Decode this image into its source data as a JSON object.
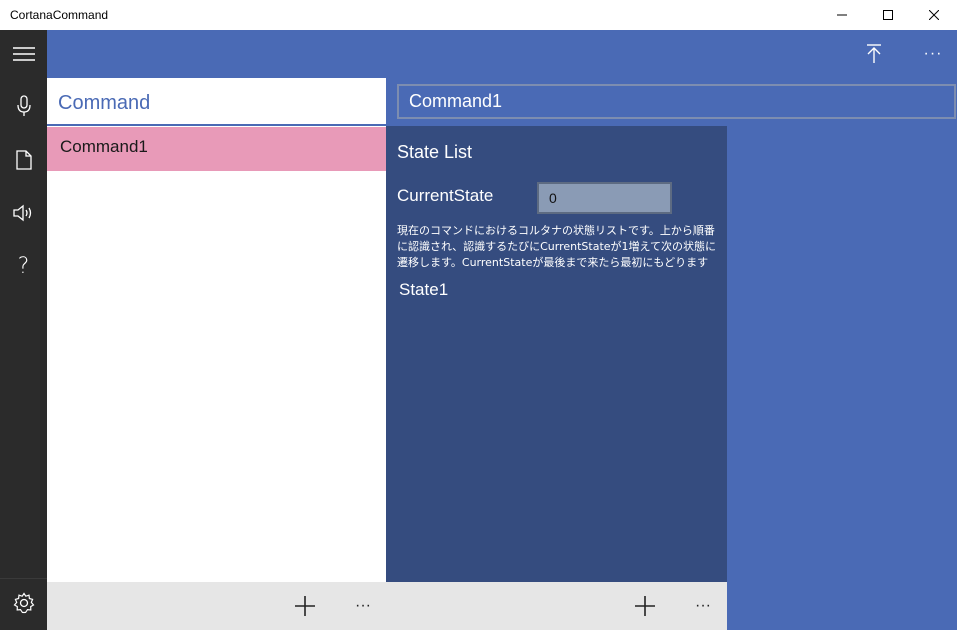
{
  "window": {
    "title": "CortanaCommand"
  },
  "rail": {
    "items": [
      {
        "icon": "hamburger-icon"
      },
      {
        "icon": "microphone-icon"
      },
      {
        "icon": "document-icon"
      },
      {
        "icon": "speaker-icon"
      },
      {
        "icon": "help-icon",
        "glyph": "?"
      }
    ],
    "settings_icon": "gear-icon"
  },
  "header": {
    "more_label": "···"
  },
  "command_list": {
    "title": "Command",
    "items": [
      {
        "label": "Command1"
      }
    ]
  },
  "command_name": {
    "value": "Command1"
  },
  "state_panel": {
    "title": "State List",
    "current_state_label": "CurrentState",
    "current_state_value": "0",
    "description": "現在のコマンドにおけるコルタナの状態リストです。上から順番に認識され、認識するたびにCurrentStateが1増えて次の状態に遷移します。CurrentStateが最後まで来たら最初にもどります",
    "states": [
      {
        "label": "State1"
      }
    ]
  },
  "bottom_bar": {
    "more_label": "···"
  },
  "colors": {
    "accent": "#4a6ab5",
    "panel": "#354c7f",
    "selected": "#e89ab8",
    "rail": "#2b2b2b"
  }
}
